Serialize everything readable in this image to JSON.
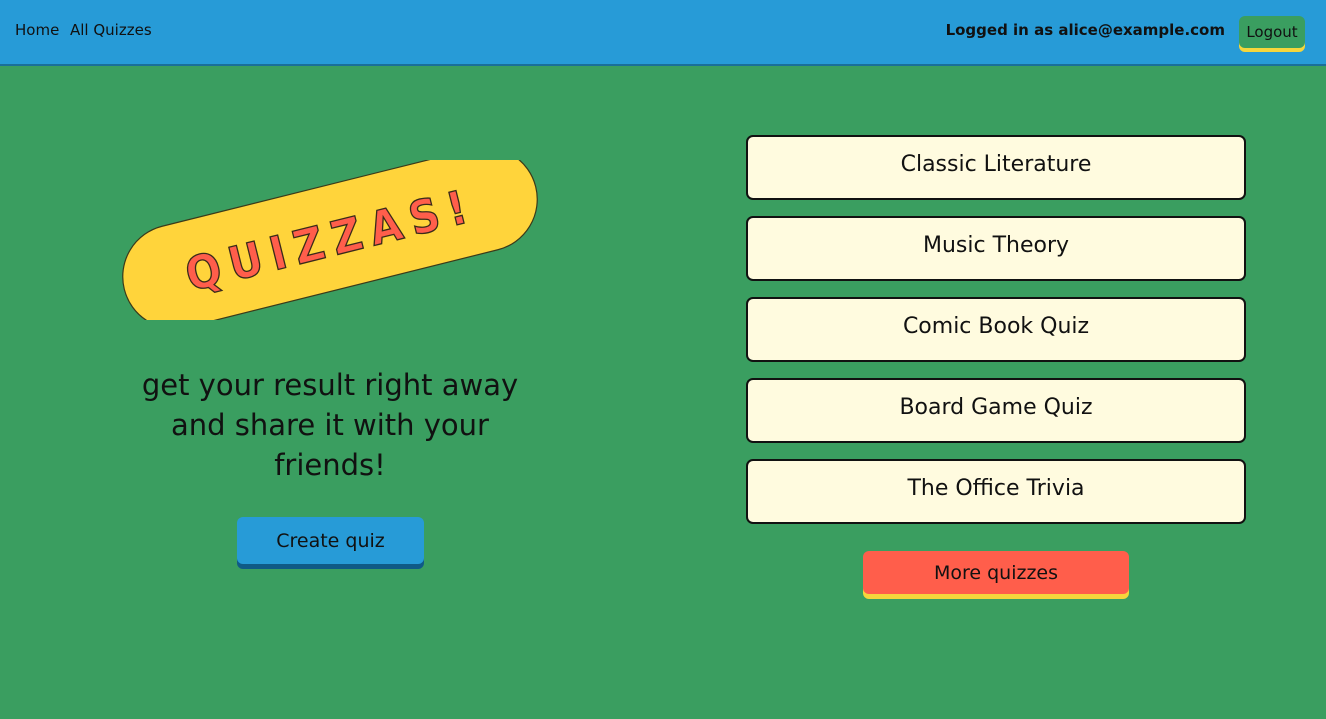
{
  "nav": {
    "home": "Home",
    "all_quizzes": "All Quizzes",
    "user_info": "Logged in as alice@example.com",
    "logout": "Logout"
  },
  "hero": {
    "logo_text": "QUIZZAS!",
    "subtitle": "get your result right away and share it with your friends!",
    "create_button": "Create quiz"
  },
  "quizzes": [
    "Classic Literature",
    "Music Theory",
    "Comic Book Quiz",
    "Board Game Quiz",
    "The Office Trivia"
  ],
  "more_button": "More quizzes",
  "colors": {
    "background": "#3a9e60",
    "navbar": "#279bd7",
    "accent_yellow": "#ffd43b",
    "logo_red": "#ff5e4b",
    "card": "#fffbdf"
  }
}
